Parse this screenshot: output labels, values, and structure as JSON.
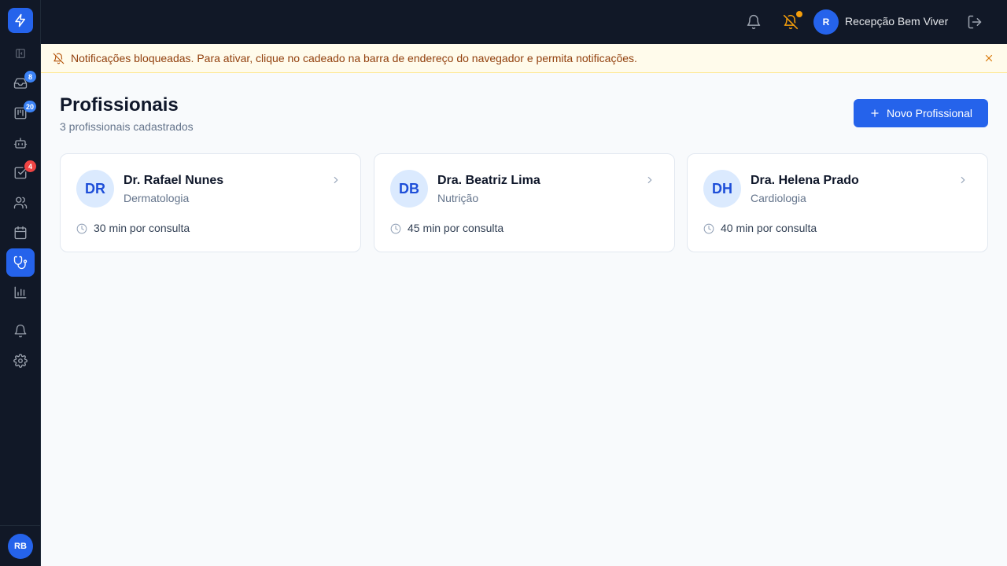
{
  "colors": {
    "accent": "#2563eb",
    "sidebar_bg": "#111827",
    "banner_bg": "#fffbeb",
    "banner_text": "#92400e",
    "badge_blue": "#3b82f6",
    "badge_red": "#ef4444",
    "notification_dot": "#f59e0b"
  },
  "sidebar": {
    "logo_icon": "lightning-icon",
    "items": [
      {
        "icon": "sidebar-toggle-icon",
        "badge": ""
      },
      {
        "icon": "inbox-icon",
        "badge": "8"
      },
      {
        "icon": "kanban-board-icon",
        "badge": "20"
      },
      {
        "icon": "bot-icon",
        "badge": ""
      },
      {
        "icon": "checkbox-icon",
        "badge": "4"
      },
      {
        "icon": "users-icon",
        "badge": ""
      },
      {
        "icon": "calendar-icon",
        "badge": ""
      },
      {
        "icon": "stethoscope-icon",
        "badge": "",
        "active": true
      },
      {
        "icon": "bar-chart-icon",
        "badge": ""
      },
      {
        "icon": "bell-icon",
        "badge": ""
      },
      {
        "icon": "gear-icon",
        "badge": ""
      }
    ],
    "user_initials": "RB"
  },
  "topbar": {
    "user_initial": "R",
    "user_name": "Recepção Bem Viver"
  },
  "banner": {
    "text": "Notificações bloqueadas. Para ativar, clique no cadeado na barra de endereço do navegador e permita notificações."
  },
  "page": {
    "title": "Profissionais",
    "subtitle": "3 profissionais cadastrados",
    "new_button_label": "Novo Profissional"
  },
  "professionals": [
    {
      "initials": "DR",
      "name": "Dr. Rafael Nunes",
      "specialty": "Dermatologia",
      "duration": "30 min por consulta"
    },
    {
      "initials": "DB",
      "name": "Dra. Beatriz Lima",
      "specialty": "Nutrição",
      "duration": "45 min por consulta"
    },
    {
      "initials": "DH",
      "name": "Dra. Helena Prado",
      "specialty": "Cardiologia",
      "duration": "40 min por consulta"
    }
  ]
}
